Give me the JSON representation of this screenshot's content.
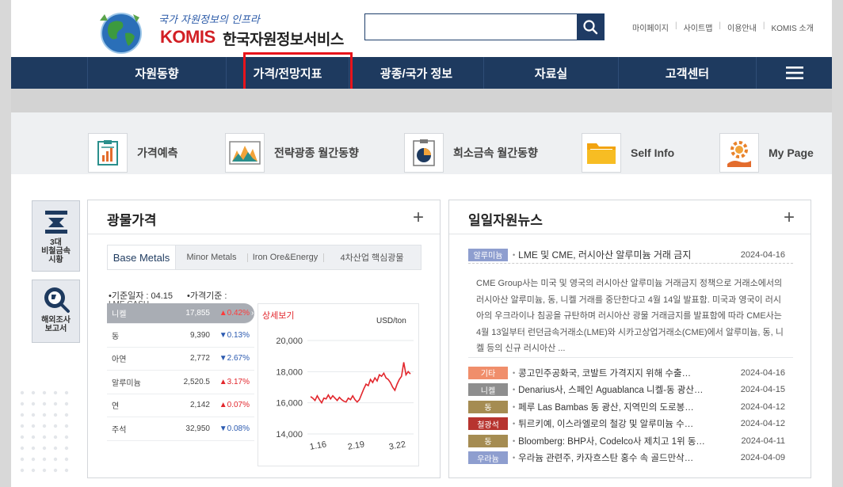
{
  "header": {
    "slogan": "국가 자원정보의 인프라",
    "brand": "KOMIS",
    "brand_name": "한국자원정보서비스",
    "search": {
      "placeholder": "",
      "value": ""
    },
    "util_links": [
      "마이페이지",
      "사이트맵",
      "이용안내",
      "KOMIS 소개"
    ]
  },
  "nav": {
    "items": [
      "자원동향",
      "가격/전망지표",
      "광종/국가 정보",
      "자료실",
      "고객센터"
    ],
    "highlighted_index": 1,
    "highlight_color": "#e8141b"
  },
  "quick_menu": [
    {
      "label": "가격예측",
      "icon": "price-forecast-icon"
    },
    {
      "label": "전략광종 월간동향",
      "icon": "strategic-minerals-chart-icon"
    },
    {
      "label": "희소금속 월간동향",
      "icon": "rare-metals-pie-icon"
    },
    {
      "label": "Self Info",
      "icon": "folder-icon"
    },
    {
      "label": "My Page",
      "icon": "gear-hand-icon"
    }
  ],
  "side_quick": [
    {
      "label": "3대\n비철금속\n시황",
      "icon": "nonferrous-icon"
    },
    {
      "label": "해외조사\n보고서",
      "icon": "globe-search-icon"
    }
  ],
  "price_panel": {
    "title": "광물가격",
    "plus": "+",
    "tabs": [
      "Base Metals",
      "Minor Metals",
      "Iron Ore&Energy",
      "4차산업 핵심광물"
    ],
    "active_tab": 0,
    "base_date_label": "•기준일자 : 04.15",
    "price_basis_label": "•가격기준 :",
    "price_basis_value": "LME CASH",
    "rows": [
      {
        "name": "니켈",
        "value": "17,855",
        "change": "▲0.42%",
        "dir": "up"
      },
      {
        "name": "동",
        "value": "9,390",
        "change": "▼0.13%",
        "dir": "down"
      },
      {
        "name": "아연",
        "value": "2,772",
        "change": "▼2.67%",
        "dir": "down"
      },
      {
        "name": "알루미늄",
        "value": "2,520.5",
        "change": "▲3.17%",
        "dir": "up"
      },
      {
        "name": "연",
        "value": "2,142",
        "change": "▲0.07%",
        "dir": "up"
      },
      {
        "name": "주석",
        "value": "32,950",
        "change": "▼0.08%",
        "dir": "down"
      }
    ],
    "detail_link": "상세보기",
    "unit": "USD/ton"
  },
  "chart_data": {
    "type": "line",
    "title": "",
    "xlabel": "",
    "ylabel": "",
    "unit": "USD/ton",
    "x_ticks": [
      "1.16",
      "2.19",
      "3.22"
    ],
    "y_ticks": [
      "20,000",
      "18,000",
      "16,000",
      "14,000"
    ],
    "ylim": [
      14000,
      20000
    ],
    "color": "#e2262c",
    "series": [
      {
        "values": [
          16400,
          16300,
          16150,
          16450,
          16200,
          16000,
          16300,
          16250,
          16500,
          16250,
          16450,
          16300,
          16150,
          16350,
          16200,
          16100,
          16050,
          16300,
          16200,
          16450,
          16200,
          16050,
          16200,
          16550,
          16900,
          17200,
          17100,
          17500,
          17300,
          17600,
          17400,
          17800,
          17700,
          17900,
          17600,
          17500,
          17300,
          17000,
          16800,
          17200,
          17500,
          17700,
          18600,
          17800,
          18000,
          17855
        ]
      }
    ]
  },
  "news_panel": {
    "title": "일일자원뉴스",
    "plus": "+",
    "headline": {
      "tag": "알루미늄",
      "tag_color": "#8e9ecf",
      "title": "LME 및 CME, 러시아산 알루미늄 거래 금지",
      "date": "2024-04-16",
      "summary": "CME Group사는 미국 및 영국의 러시아산 알루미늄 거래금지 정책으로 거래소에서의 러시아산 알루미늄, 동, 니켈 거래를 중단한다고 4월 14일 발표함. 미국과 영국이 러시아의 우크라이나 침공을 규탄하며 러시아산 광물 거래금지를 발표함에 따라 CME사는 4월 13일부터 런던금속거래소(LME)와 시카고상업거래소(CME)에서 알루미늄, 동, 니켈 등의 신규 러시아산 ..."
    },
    "items": [
      {
        "tag": "기타",
        "tag_color": "#f08e6b",
        "title": "콩고민주공화국, 코발트 가격지지 위해 수출…",
        "date": "2024-04-16"
      },
      {
        "tag": "니켈",
        "tag_color": "#8e8e8e",
        "title": "Denarius사, 스페인 Aguablanca 니켈-동 광산…",
        "date": "2024-04-15"
      },
      {
        "tag": "동",
        "tag_color": "#a58c52",
        "title": "페루 Las Bambas 동 광산, 지역민의 도로봉…",
        "date": "2024-04-12"
      },
      {
        "tag": "철광석",
        "tag_color": "#b7342f",
        "title": "튀르키예, 이스라엘로의 철강 및 알루미늄 수…",
        "date": "2024-04-12"
      },
      {
        "tag": "동",
        "tag_color": "#a58c52",
        "title": "Bloomberg: BHP사, Codelco사 제치고 1위 동…",
        "date": "2024-04-11"
      },
      {
        "tag": "우라늄",
        "tag_color": "#8e9ecf",
        "title": "우라늄 관련주, 카자흐스탄 홍수 속 골드만삭…",
        "date": "2024-04-09"
      }
    ]
  }
}
